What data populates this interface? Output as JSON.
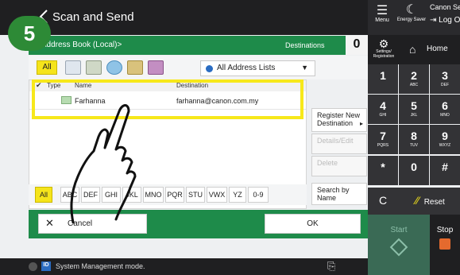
{
  "step_number": "5",
  "header": {
    "title": "Scan and Send",
    "menu_label": "Menu",
    "energy_label": "Energy Saver",
    "user_name": "Canon Service Acc",
    "logout_label": "Log Out"
  },
  "address_book": {
    "title": "<Address Book (Local)>",
    "destinations_label": "Destinations",
    "destinations_count": "0",
    "all_button": "All",
    "list_selector": "All Address Lists"
  },
  "table": {
    "col_type": "Type",
    "col_name": "Name",
    "col_destination": "Destination",
    "rows": [
      {
        "name": "Farhanna",
        "destination": "farhanna@canon.com.my"
      }
    ]
  },
  "side_buttons": {
    "register": "Register New Destination",
    "details": "Details/Edit",
    "delete": "Delete",
    "search": "Search by Name"
  },
  "alphabet": [
    "All",
    "ABC",
    "DEF",
    "GHI",
    "JKL",
    "MNO",
    "PQR",
    "STU",
    "VWX",
    "YZ",
    "0-9"
  ],
  "footer": {
    "cancel": "Cancel",
    "ok": "OK"
  },
  "status": {
    "id_badge": "ID",
    "message": "System Management mode."
  },
  "keypad": {
    "settings_label": "Settings/ Registration",
    "home_label": "Home",
    "keys": [
      {
        "n": "1",
        "l": ""
      },
      {
        "n": "2",
        "l": "ABC"
      },
      {
        "n": "3",
        "l": "DEF"
      },
      {
        "n": "4",
        "l": "GHI"
      },
      {
        "n": "5",
        "l": "JKL"
      },
      {
        "n": "6",
        "l": "MNO"
      },
      {
        "n": "7",
        "l": "PQRS"
      },
      {
        "n": "8",
        "l": "TUV"
      },
      {
        "n": "9",
        "l": "WXYZ"
      },
      {
        "n": "*",
        "l": ""
      },
      {
        "n": "0",
        "l": ""
      },
      {
        "n": "#",
        "l": ""
      }
    ],
    "clear_label": "C",
    "reset_label": "Reset",
    "start_label": "Start",
    "stop_label": "Stop"
  },
  "colors": {
    "accent_green": "#1e8b4a",
    "highlight_yellow": "#f7e81a",
    "step_badge_green": "#2d8a36"
  }
}
